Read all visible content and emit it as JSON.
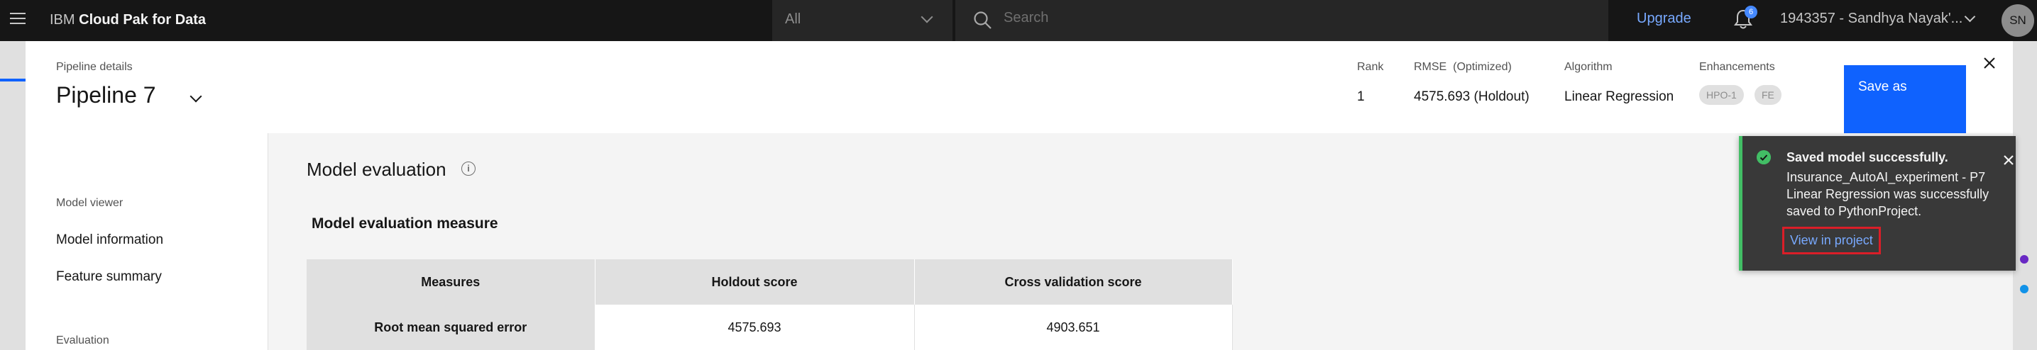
{
  "header": {
    "brand_prefix": "IBM",
    "brand_name": "Cloud Pak for Data",
    "scope_value": "All",
    "search_placeholder": "Search",
    "upgrade_label": "Upgrade",
    "notification_count": "6",
    "account_label": "1943357 - Sandhya Nayak'...",
    "avatar_initials": "SN"
  },
  "pipeline": {
    "details_label": "Pipeline details",
    "title": "Pipeline 7",
    "rank_label": "Rank",
    "rank_value": "1",
    "rmse_label": "RMSE  (Optimized)",
    "rmse_value": "4575.693 (Holdout)",
    "algorithm_label": "Algorithm",
    "algorithm_value": "Linear Regression",
    "enhancements_label": "Enhancements",
    "enhancements": [
      "HPO-1",
      "FE"
    ],
    "save_label": "Save as"
  },
  "sidenav": {
    "model_viewer_label": "Model viewer",
    "items": [
      "Model information",
      "Feature summary"
    ],
    "evaluation_label": "Evaluation"
  },
  "main": {
    "title": "Model evaluation",
    "info_icon": "i",
    "subtitle": "Model evaluation measure",
    "table": {
      "headers": [
        "Measures",
        "Holdout score",
        "Cross validation score"
      ],
      "rows": [
        [
          "Root mean squared error",
          "4575.693",
          "4903.651"
        ]
      ]
    }
  },
  "toast": {
    "title": "Saved model successfully.",
    "body": "Insurance_AutoAI_experiment - P7 Linear Regression was successfully saved to PythonProject.",
    "link": "View in project"
  },
  "colors": {
    "header_bg": "#161616",
    "accent": "#0f62fe",
    "success": "#42be65",
    "highlight_border": "#da1e28",
    "link": "#78a9ff"
  },
  "icons": [
    "hamburger-icon",
    "chevron-down-icon",
    "search-icon",
    "bell-icon",
    "close-icon",
    "info-icon",
    "checkmark-icon"
  ]
}
